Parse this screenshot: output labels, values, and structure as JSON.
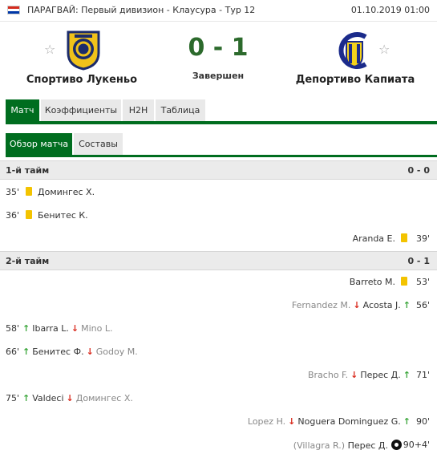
{
  "header": {
    "competition": "ПАРАГВАЙ: Первый дивизион - Клаусура - Тур 12",
    "datetime": "01.10.2019 01:00"
  },
  "match": {
    "home_team": "Спортиво Лукеньо",
    "away_team": "Депортиво Капиата",
    "score": "0 - 1",
    "status": "Завершен"
  },
  "tabs": [
    "Матч",
    "Коэффициенты",
    "H2H",
    "Таблица"
  ],
  "subtabs": [
    "Обзор матча",
    "Составы"
  ],
  "halves": [
    {
      "label": "1-й тайм",
      "score": "0 - 0"
    },
    {
      "label": "2-й тайм",
      "score": "0 - 1"
    }
  ],
  "events": [
    {
      "minute": "35'",
      "player": "Домингес Х."
    },
    {
      "minute": "36'",
      "player": "Бенитес К."
    },
    {
      "minute": "39'",
      "player": "Aranda E."
    },
    {
      "minute": "53'",
      "player": "Barreto M."
    },
    {
      "minute": "56'",
      "in": "Acosta J.",
      "out": "Fernandez M."
    },
    {
      "minute": "58'",
      "in": "Ibarra L.",
      "out": "Mino L."
    },
    {
      "minute": "66'",
      "in": "Бенитес Ф.",
      "out": "Godoy M."
    },
    {
      "minute": "71'",
      "in": "Перес Д.",
      "out": "Bracho F."
    },
    {
      "minute": "75'",
      "in": "Valdeci",
      "out": "Домингес Х."
    },
    {
      "minute": "90'",
      "in": "Noguera Dominguez G.",
      "out": "Lopez H."
    },
    {
      "minute": "90+4'",
      "player": "Перес Д.",
      "assist": "(Villagra R.)"
    }
  ],
  "colors": {
    "accent": "#006d1f",
    "score": "#2c6a2c",
    "yellow_card": "#f3c300",
    "sub_in": "#3aa63a",
    "sub_out": "#d9291c"
  }
}
